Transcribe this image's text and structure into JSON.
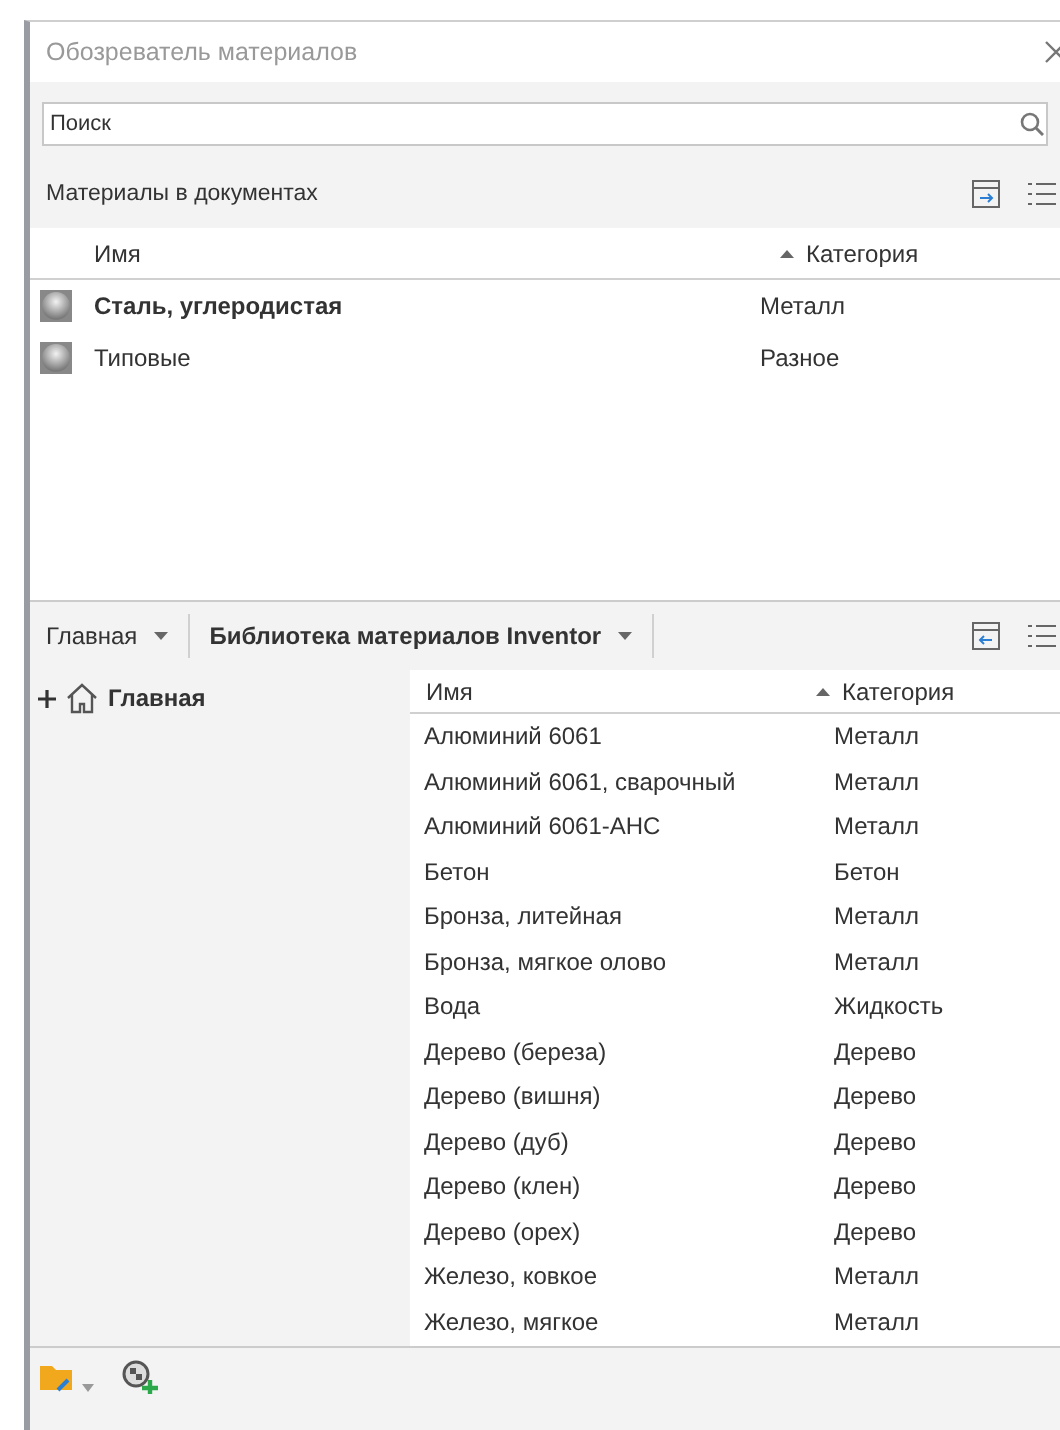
{
  "window": {
    "title": "Обозреватель материалов"
  },
  "search": {
    "placeholder": "Поиск"
  },
  "document_materials": {
    "title": "Материалы в документах",
    "columns": [
      {
        "label": "Имя",
        "sorted": false
      },
      {
        "label": "Категория",
        "sorted": true
      }
    ],
    "rows": [
      {
        "name": "Сталь, углеродистая",
        "category": "Металл",
        "active": true
      },
      {
        "name": "Типовые",
        "category": "Разное",
        "active": false
      }
    ]
  },
  "library_bar": {
    "crumbs": [
      {
        "label": "Главная",
        "current": false
      },
      {
        "label": "Библиотека материалов Inventor",
        "current": true
      }
    ]
  },
  "tree": {
    "items": [
      {
        "label": "Главная",
        "expanded": false
      }
    ]
  },
  "library": {
    "columns": [
      {
        "label": "Имя",
        "sorted": false
      },
      {
        "label": "Категория",
        "sorted": true
      }
    ],
    "rows": [
      {
        "name": "Алюминий 6061",
        "category": "Металл"
      },
      {
        "name": "Алюминий 6061, сварочный",
        "category": "Металл"
      },
      {
        "name": "Алюминий 6061-AHC",
        "category": "Металл"
      },
      {
        "name": "Бетон",
        "category": "Бетон"
      },
      {
        "name": "Бронза, литейная",
        "category": "Металл"
      },
      {
        "name": "Бронза, мягкое олово",
        "category": "Металл"
      },
      {
        "name": "Вода",
        "category": "Жидкость"
      },
      {
        "name": "Дерево (береза)",
        "category": "Дерево"
      },
      {
        "name": "Дерево (вишня)",
        "category": "Дерево"
      },
      {
        "name": "Дерево (дуб)",
        "category": "Дерево"
      },
      {
        "name": "Дерево (клен)",
        "category": "Дерево"
      },
      {
        "name": "Дерево (орех)",
        "category": "Дерево"
      },
      {
        "name": "Железо, ковкое",
        "category": "Металл"
      },
      {
        "name": "Железо, мягкое",
        "category": "Металл"
      }
    ]
  }
}
